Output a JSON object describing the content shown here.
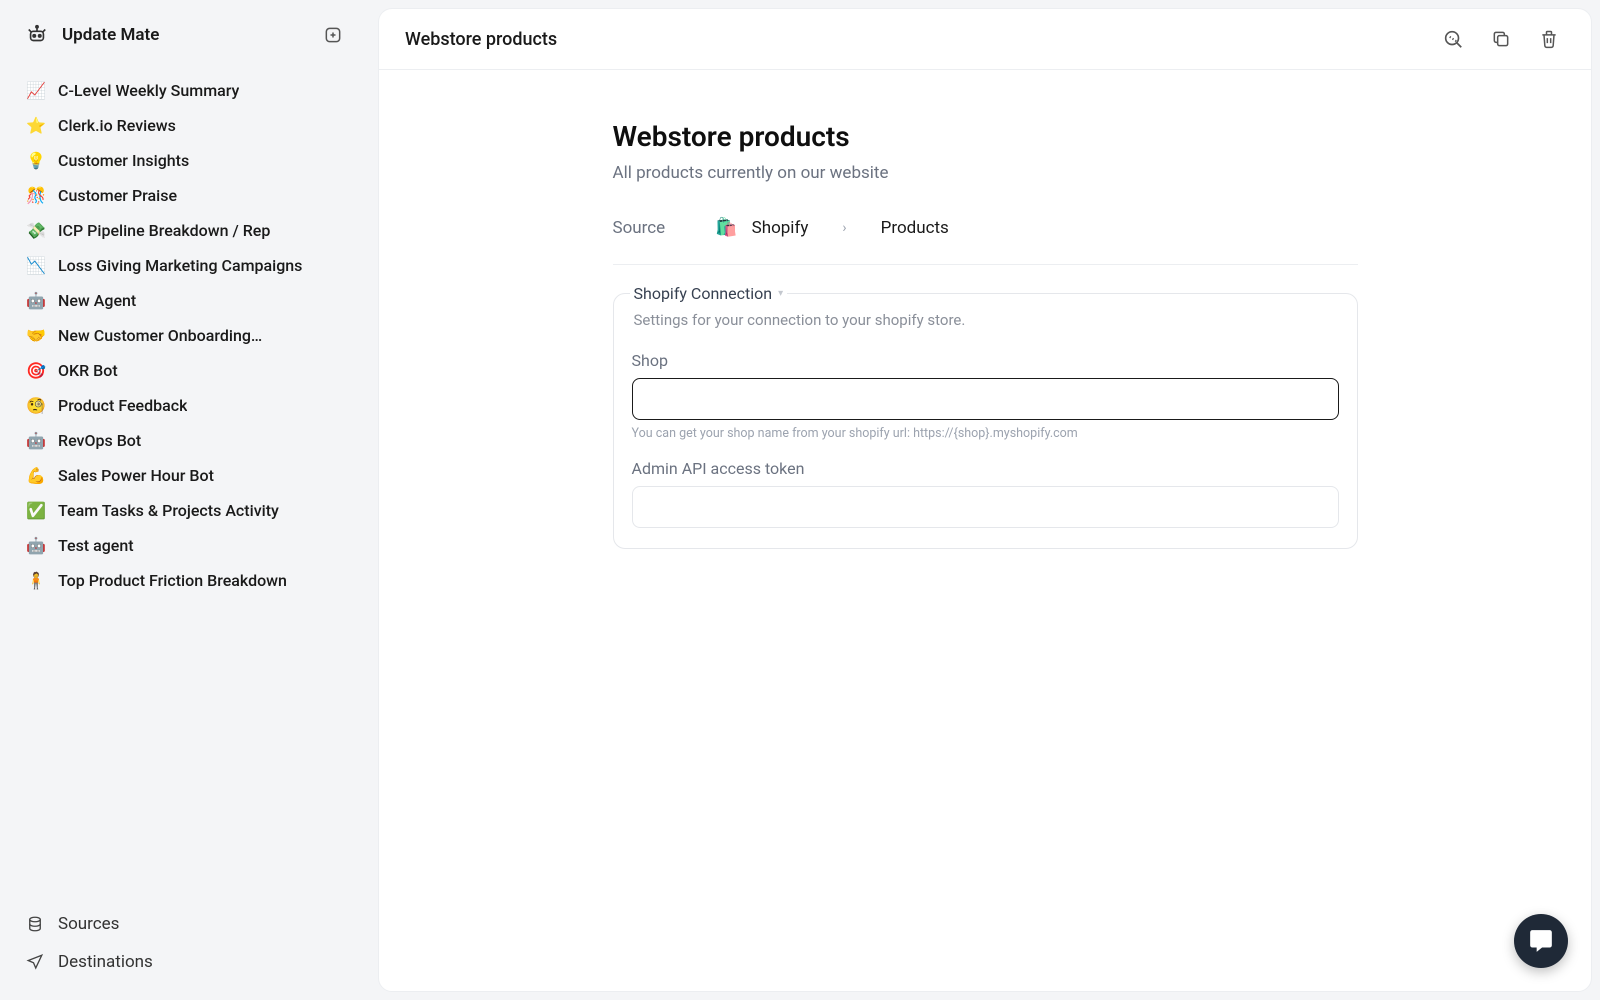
{
  "sidebar": {
    "brand": "Update Mate",
    "items": [
      {
        "emoji": "📈",
        "label": "C-Level Weekly Summary"
      },
      {
        "emoji": "⭐",
        "label": "Clerk.io Reviews"
      },
      {
        "emoji": "💡",
        "label": "Customer Insights"
      },
      {
        "emoji": "🎊",
        "label": "Customer Praise"
      },
      {
        "emoji": "💸",
        "label": "ICP Pipeline Breakdown / Rep"
      },
      {
        "emoji": "📉",
        "label": "Loss Giving Marketing Campaigns"
      },
      {
        "emoji": "🤖",
        "label": "New Agent"
      },
      {
        "emoji": "🤝",
        "label": "New Customer Onboarding…"
      },
      {
        "emoji": "🎯",
        "label": "OKR Bot"
      },
      {
        "emoji": "🧐",
        "label": "Product Feedback"
      },
      {
        "emoji": "🤖",
        "label": "RevOps Bot"
      },
      {
        "emoji": "💪",
        "label": "Sales Power Hour Bot"
      },
      {
        "emoji": "✅",
        "label": "Team Tasks & Projects Activity"
      },
      {
        "emoji": "🤖",
        "label": "Test agent"
      },
      {
        "emoji": "🧍",
        "label": "Top Product Friction Breakdown"
      }
    ],
    "footer": [
      {
        "label": "Sources"
      },
      {
        "label": "Destinations"
      }
    ]
  },
  "header": {
    "title": "Webstore products"
  },
  "main": {
    "title": "Webstore products",
    "subtitle": "All products currently on our website",
    "source": {
      "label": "Source",
      "provider": "Shopify",
      "separator": "›",
      "type": "Products"
    },
    "panel": {
      "title": "Shopify Connection",
      "subtitle": "Settings for your connection to your shopify store.",
      "fields": {
        "shop": {
          "label": "Shop",
          "value": "",
          "hint": "You can get your shop name from your shopify url: https://{shop}.myshopify.com"
        },
        "token": {
          "label": "Admin API access token",
          "value": ""
        }
      }
    }
  }
}
